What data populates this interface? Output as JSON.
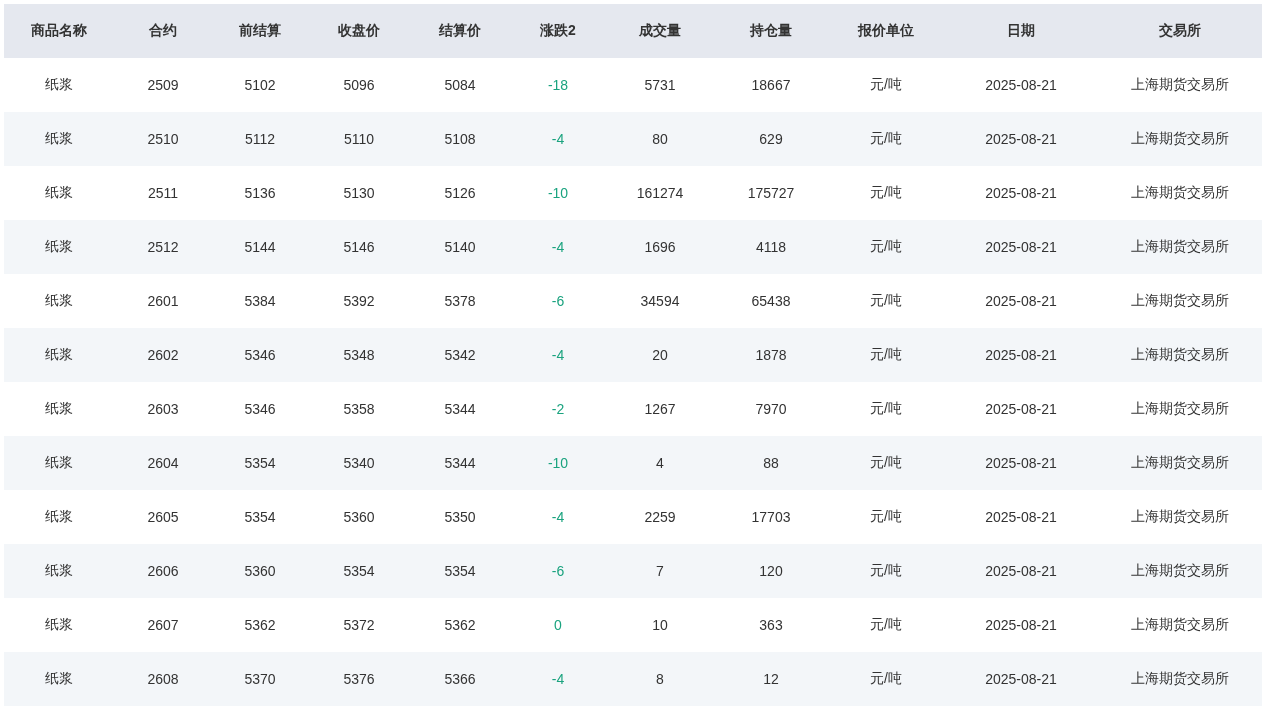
{
  "table": {
    "columns": [
      "商品名称",
      "合约",
      "前结算",
      "收盘价",
      "结算价",
      "涨跌2",
      "成交量",
      "持仓量",
      "报价单位",
      "日期",
      "交易所"
    ],
    "rows": [
      [
        "纸浆",
        "2509",
        "5102",
        "5096",
        "5084",
        "-18",
        "5731",
        "18667",
        "元/吨",
        "2025-08-21",
        "上海期货交易所"
      ],
      [
        "纸浆",
        "2510",
        "5112",
        "5110",
        "5108",
        "-4",
        "80",
        "629",
        "元/吨",
        "2025-08-21",
        "上海期货交易所"
      ],
      [
        "纸浆",
        "2511",
        "5136",
        "5130",
        "5126",
        "-10",
        "161274",
        "175727",
        "元/吨",
        "2025-08-21",
        "上海期货交易所"
      ],
      [
        "纸浆",
        "2512",
        "5144",
        "5146",
        "5140",
        "-4",
        "1696",
        "4118",
        "元/吨",
        "2025-08-21",
        "上海期货交易所"
      ],
      [
        "纸浆",
        "2601",
        "5384",
        "5392",
        "5378",
        "-6",
        "34594",
        "65438",
        "元/吨",
        "2025-08-21",
        "上海期货交易所"
      ],
      [
        "纸浆",
        "2602",
        "5346",
        "5348",
        "5342",
        "-4",
        "20",
        "1878",
        "元/吨",
        "2025-08-21",
        "上海期货交易所"
      ],
      [
        "纸浆",
        "2603",
        "5346",
        "5358",
        "5344",
        "-2",
        "1267",
        "7970",
        "元/吨",
        "2025-08-21",
        "上海期货交易所"
      ],
      [
        "纸浆",
        "2604",
        "5354",
        "5340",
        "5344",
        "-10",
        "4",
        "88",
        "元/吨",
        "2025-08-21",
        "上海期货交易所"
      ],
      [
        "纸浆",
        "2605",
        "5354",
        "5360",
        "5350",
        "-4",
        "2259",
        "17703",
        "元/吨",
        "2025-08-21",
        "上海期货交易所"
      ],
      [
        "纸浆",
        "2606",
        "5360",
        "5354",
        "5354",
        "-6",
        "7",
        "120",
        "元/吨",
        "2025-08-21",
        "上海期货交易所"
      ],
      [
        "纸浆",
        "2607",
        "5362",
        "5372",
        "5362",
        "0",
        "10",
        "363",
        "元/吨",
        "2025-08-21",
        "上海期货交易所"
      ],
      [
        "纸浆",
        "2608",
        "5370",
        "5376",
        "5366",
        "-4",
        "8",
        "12",
        "元/吨",
        "2025-08-21",
        "上海期货交易所"
      ]
    ]
  }
}
